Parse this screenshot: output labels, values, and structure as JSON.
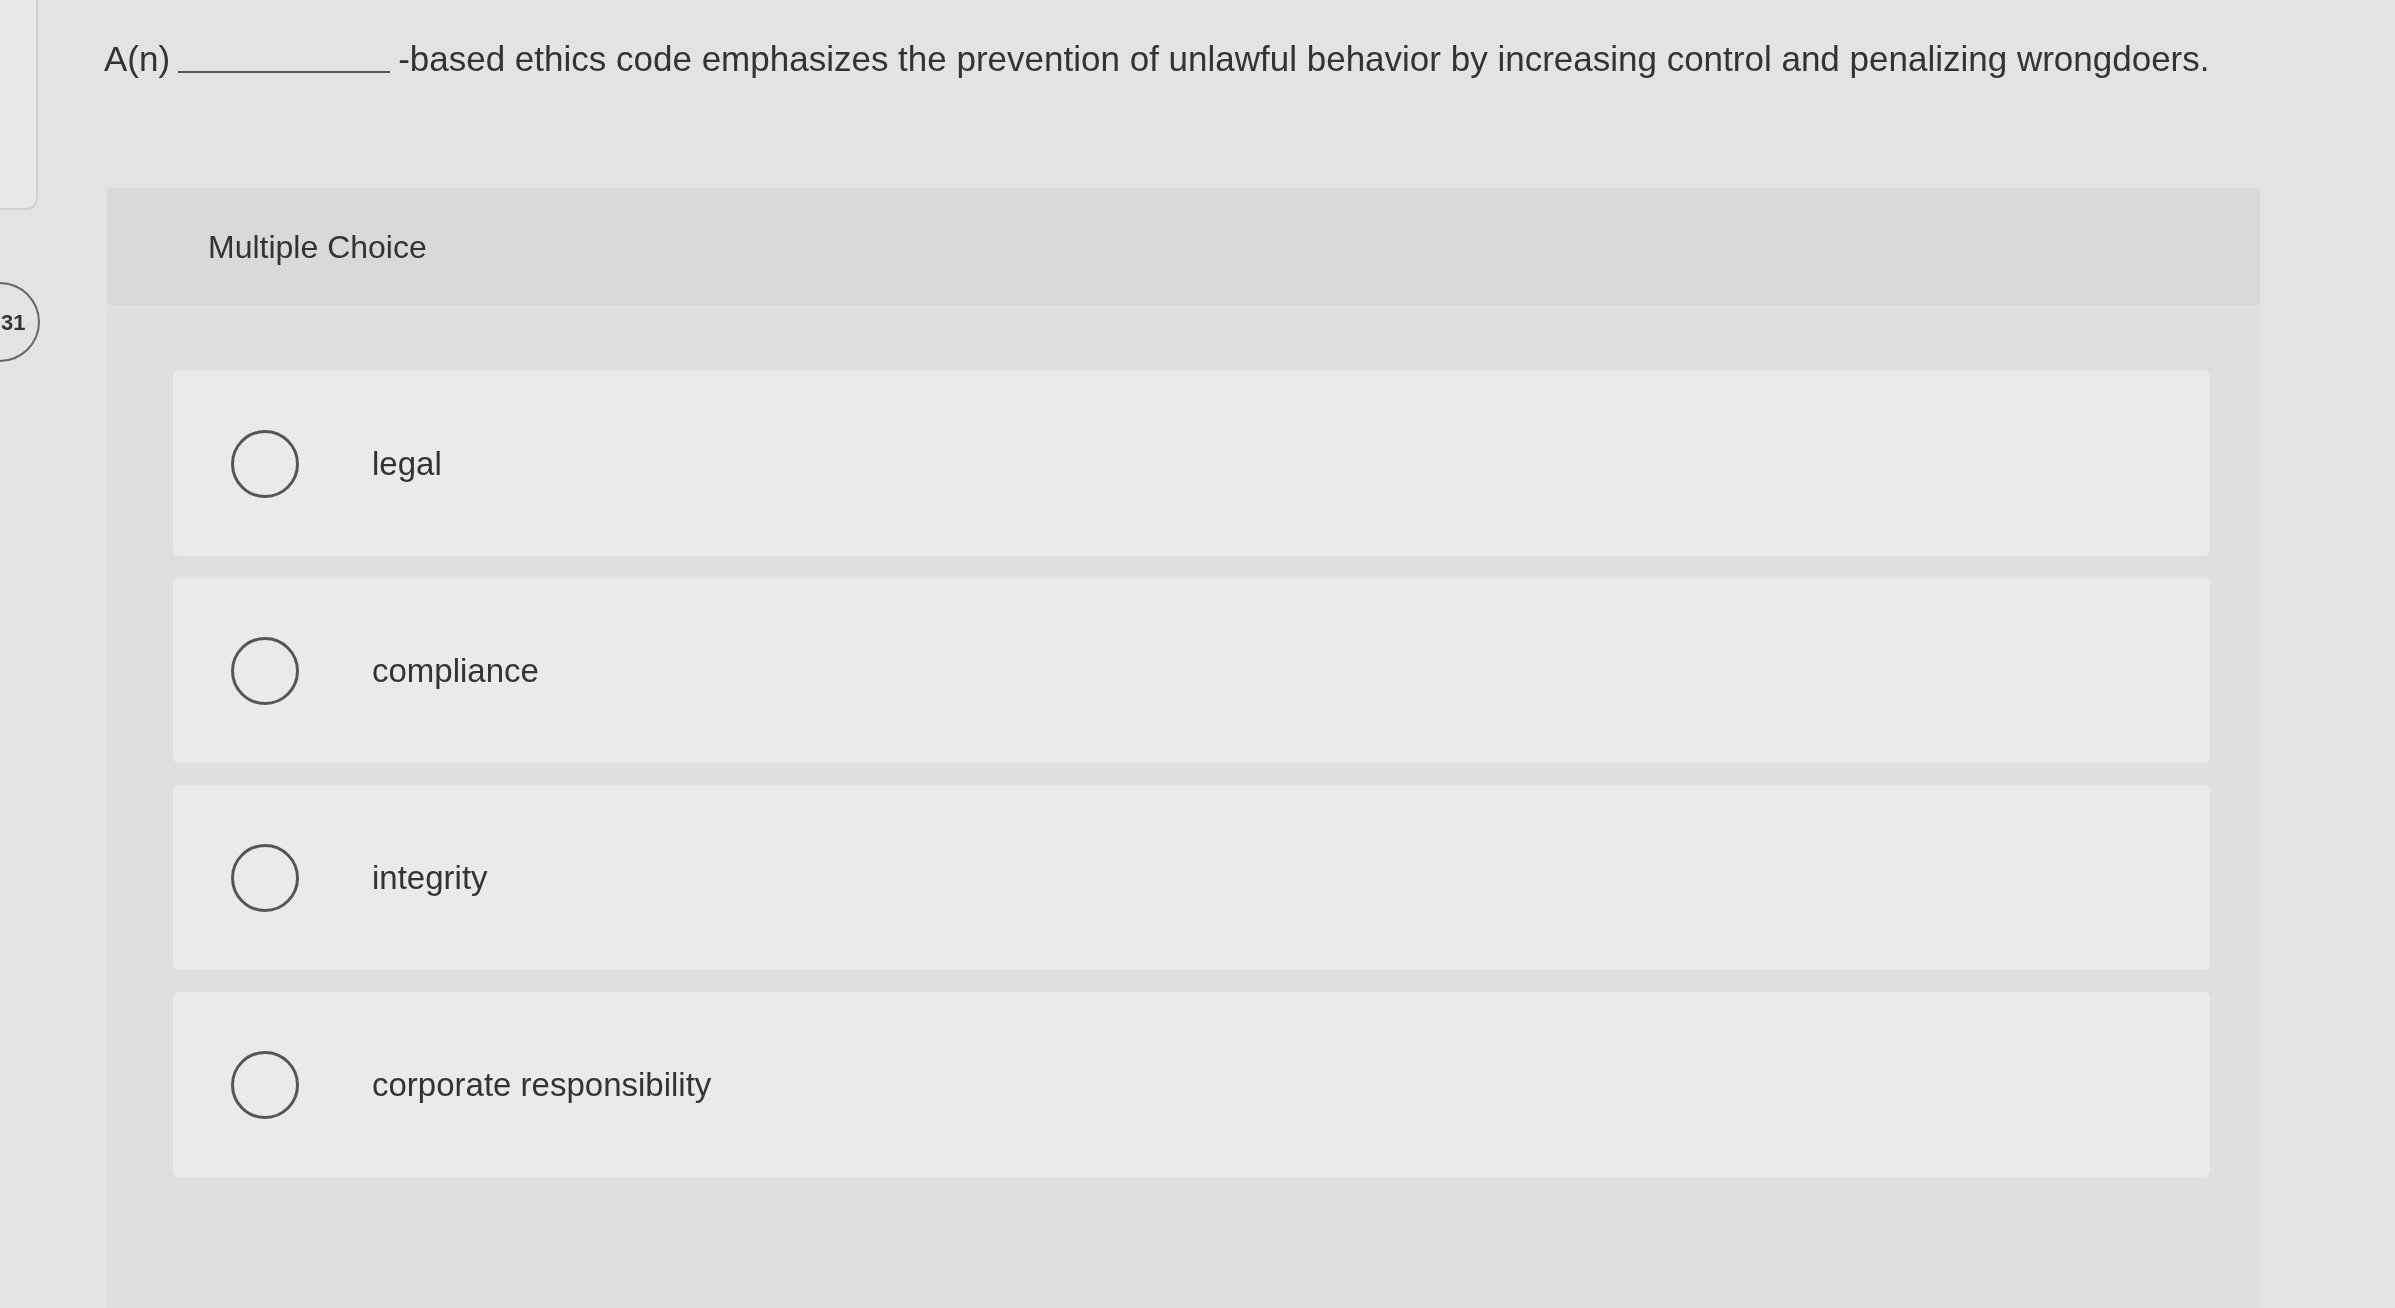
{
  "sidebar": {
    "question_number": "31"
  },
  "question": {
    "before_blank": "A(n)",
    "after_blank": "-based ethics code emphasizes the prevention of unlawful behavior by increasing control and penalizing wrongdoers."
  },
  "answer_panel": {
    "heading": "Multiple Choice",
    "options": [
      {
        "label": "legal",
        "selected": false
      },
      {
        "label": "compliance",
        "selected": false
      },
      {
        "label": "integrity",
        "selected": false
      },
      {
        "label": "corporate responsibility",
        "selected": false
      }
    ]
  }
}
